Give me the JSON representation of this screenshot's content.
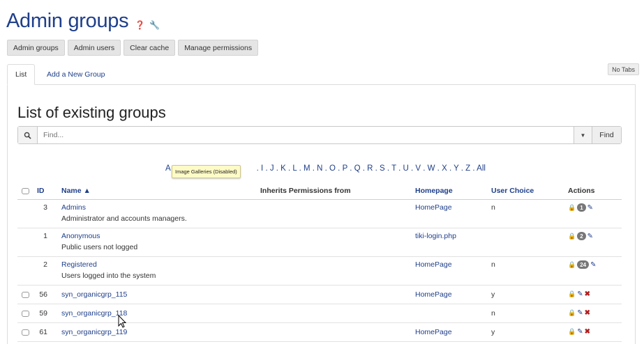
{
  "title": "Admin groups",
  "title_icons": [
    "help-icon",
    "wrench-icon"
  ],
  "toolbar": [
    "Admin groups",
    "Admin users",
    "Clear cache",
    "Manage permissions"
  ],
  "tabs": {
    "list": "List",
    "add": "Add a New Group",
    "no_tabs": "No Tabs"
  },
  "list_heading": "List of existing groups",
  "search": {
    "placeholder": "Find...",
    "find": "Find"
  },
  "alpha": {
    "first": "A",
    "rest": ". I . J . K . L . M . N . O . P . Q . R . S . T . U . V . W . X . Y . Z . All"
  },
  "tooltip": "Image Galleries (Disabled)",
  "columns": {
    "id": "ID",
    "name": "Name",
    "inherits": "Inherits Permissions from",
    "homepage": "Homepage",
    "choice": "User Choice",
    "actions": "Actions"
  },
  "rows": [
    {
      "id": "3",
      "name": "Admins",
      "desc": "Administrator and accounts managers.",
      "homepage": "HomePage",
      "choice": "n",
      "badge": "1"
    },
    {
      "id": "1",
      "name": "Anonymous",
      "desc": "Public users not logged",
      "homepage": "tiki-login.php",
      "choice": "",
      "badge": "2"
    },
    {
      "id": "2",
      "name": "Registered",
      "desc": "Users logged into the system",
      "homepage": "HomePage",
      "choice": "n",
      "badge": "24"
    },
    {
      "id": "56",
      "name": "syn_organicgrp_115",
      "homepage": "HomePage",
      "choice": "y"
    },
    {
      "id": "59",
      "name": "syn_organicgrp_118",
      "homepage": "",
      "choice": "n"
    },
    {
      "id": "61",
      "name": "syn_organicgrp_119",
      "homepage": "HomePage",
      "choice": "y"
    }
  ],
  "colors": {
    "link": "#1f3f8a",
    "delete": "#b21e1e"
  }
}
